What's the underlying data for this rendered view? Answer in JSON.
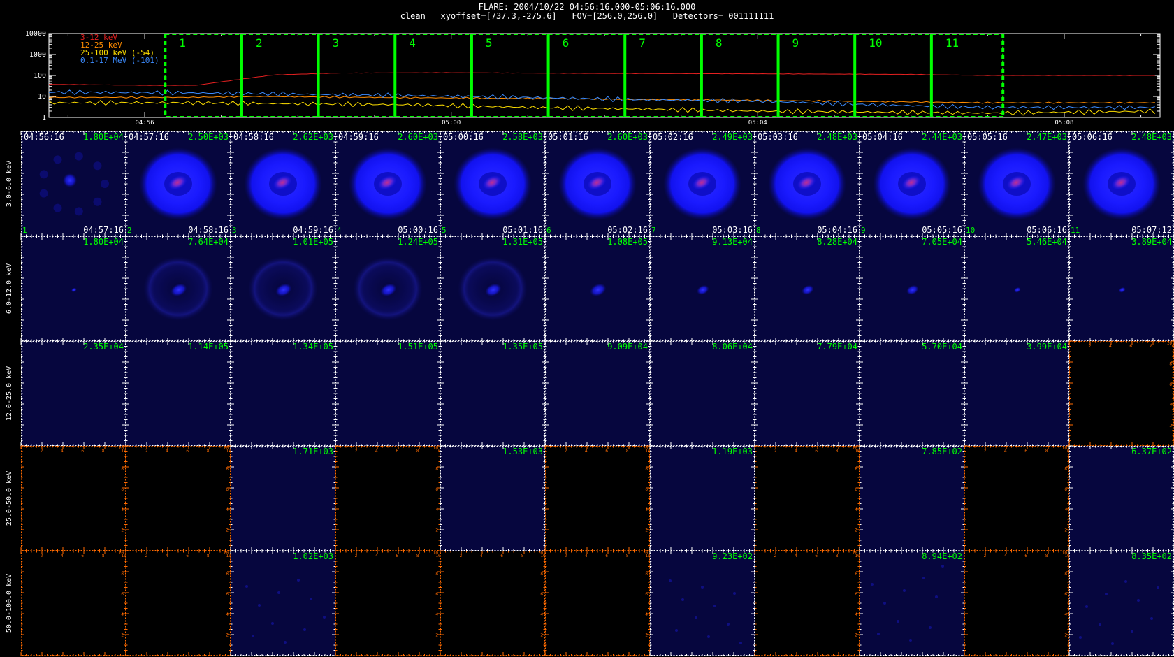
{
  "header": {
    "line1": "FLARE: 2004/10/22 04:56:16.000-05:06:16.000",
    "line2": "clean   xyoffset=[737.3,-275.6]   FOV=[256.0,256.0]   Detectors= 001111111"
  },
  "chart_data": [
    {
      "type": "line",
      "yscale": "log",
      "ylim": [
        1,
        10000
      ],
      "y_tick_labels": [
        "1",
        "10",
        "100",
        "1000",
        "10000"
      ],
      "x_tick_labels": [
        "04:56",
        "05:00",
        "05:04",
        "05:08"
      ],
      "x_tick_times": [
        "04:56",
        "05:00",
        "05:04",
        "05:08"
      ],
      "xlim": [
        "04:54:45",
        "05:09:15"
      ],
      "legend": {
        "placement": "top-left"
      },
      "series": [
        {
          "name": "3-12 keV",
          "color": "#e62020",
          "x": [
            "04:54:45",
            "04:56:00",
            "04:56:40",
            "04:57:10",
            "04:57:40",
            "04:58:30",
            "05:00:00",
            "05:02:00",
            "05:04:00",
            "05:06:00",
            "05:07:00",
            "05:09:15"
          ],
          "y": [
            38,
            34,
            34,
            60,
            105,
            130,
            135,
            125,
            120,
            112,
            100,
            100
          ]
        },
        {
          "name": "12-25 keV",
          "color": "#ff8c00",
          "x": [
            "04:54:45",
            "04:56:30",
            "04:57:30",
            "04:59:00",
            "05:01:00",
            "05:03:00",
            "05:05:00",
            "05:07:00",
            "05:09:15"
          ],
          "y": [
            9,
            9,
            10,
            9,
            8,
            7,
            6,
            5,
            5
          ]
        },
        {
          "name": "25-100 keV (-54)",
          "color": "#ffe000",
          "x": [
            "04:54:45",
            "04:56:30",
            "04:58:00",
            "04:59:30",
            "05:01:00",
            "05:02:30",
            "05:04:00",
            "05:05:30",
            "05:07:00",
            "05:09:15"
          ],
          "y": [
            5,
            5,
            4.5,
            4,
            3,
            2.5,
            2,
            1.8,
            1.6,
            2
          ]
        },
        {
          "name": "0.1-17 MeV (-101)",
          "color": "#3c8cff",
          "x": [
            "04:54:45",
            "04:56:30",
            "04:58:00",
            "04:59:30",
            "05:01:00",
            "05:02:30",
            "05:04:00",
            "05:05:30",
            "05:07:00",
            "05:09:15"
          ],
          "y": [
            16,
            15,
            13,
            11,
            9,
            7,
            6,
            4,
            3,
            3
          ]
        }
      ],
      "intervals": [
        {
          "label": "1",
          "start": "04:56:16",
          "end": "04:57:16"
        },
        {
          "label": "2",
          "start": "04:57:16",
          "end": "04:58:16"
        },
        {
          "label": "3",
          "start": "04:58:16",
          "end": "04:59:16"
        },
        {
          "label": "4",
          "start": "04:59:16",
          "end": "05:00:16"
        },
        {
          "label": "5",
          "start": "05:00:16",
          "end": "05:01:16"
        },
        {
          "label": "6",
          "start": "05:01:16",
          "end": "05:02:16"
        },
        {
          "label": "7",
          "start": "05:02:16",
          "end": "05:03:16"
        },
        {
          "label": "8",
          "start": "05:03:16",
          "end": "05:04:16"
        },
        {
          "label": "9",
          "start": "05:04:16",
          "end": "05:05:16"
        },
        {
          "label": "10",
          "start": "05:05:16",
          "end": "05:06:16"
        },
        {
          "label": "11",
          "start": "05:06:16",
          "end": "05:07:12"
        }
      ],
      "interval_color": "#00ff00"
    },
    {
      "type": "heatmap",
      "columns": [
        "1",
        "2",
        "3",
        "4",
        "5",
        "6",
        "7",
        "8",
        "9",
        "10",
        "11"
      ],
      "col_start_times": [
        "04:56:16",
        "04:57:16",
        "04:58:16",
        "04:59:16",
        "05:00:16",
        "05:01:16",
        "05:02:16",
        "05:03:16",
        "05:04:16",
        "05:05:16",
        "05:06:16"
      ],
      "col_end_times": [
        "04:57:16",
        "04:58:16",
        "04:59:16",
        "05:00:16",
        "05:01:16",
        "05:02:16",
        "05:03:16",
        "05:04:16",
        "05:05:16",
        "05:06:16",
        "05:07:12"
      ],
      "rows": [
        {
          "energy": "3.0-6.0 keV",
          "max": [
            "1.80E+04",
            "2.50E+03",
            "2.62E+03",
            "2.60E+03",
            "2.58E+03",
            "2.60E+03",
            "2.49E+03",
            "2.48E+03",
            "2.44E+03",
            "2.47E+03",
            "2.48E+03"
          ]
        },
        {
          "energy": "6.0-12.0 keV",
          "max": [
            "1.80E+04",
            "7.64E+04",
            "1.01E+05",
            "1.24E+05",
            "1.31E+05",
            "1.08E+05",
            "9.13E+04",
            "8.28E+04",
            "7.05E+04",
            "5.46E+04",
            "3.89E+04"
          ]
        },
        {
          "energy": "12.0-25.0 keV",
          "max": [
            "2.35E+04",
            "1.14E+05",
            "1.34E+05",
            "1.51E+05",
            "1.35E+05",
            "9.09E+04",
            "8.06E+04",
            "7.79E+04",
            "5.70E+04",
            "3.99E+04",
            ""
          ]
        },
        {
          "energy": "25.0-50.0 keV",
          "max": [
            "",
            "",
            "1.71E+03",
            "",
            "1.53E+03",
            "",
            "1.19E+03",
            "",
            "7.85E+02",
            "",
            "6.37E+02"
          ]
        },
        {
          "energy": "50.0-100.0 keV",
          "max": [
            "",
            "",
            "1.02E+03",
            "",
            "",
            "",
            "9.23E+02",
            "",
            "8.94E+02",
            "",
            "8.35E+02"
          ]
        }
      ],
      "empty_axis_tick_labels": [
        "2",
        "4",
        "6",
        "8",
        "10"
      ],
      "colors": {
        "label": "#00ff00",
        "time": "#ffffff",
        "grid": "#ffffff",
        "empty_grid": "#ff6a00",
        "panel_bg": "#06063e",
        "source_blue": "#1414ff",
        "source_core": "#a02080"
      }
    }
  ]
}
